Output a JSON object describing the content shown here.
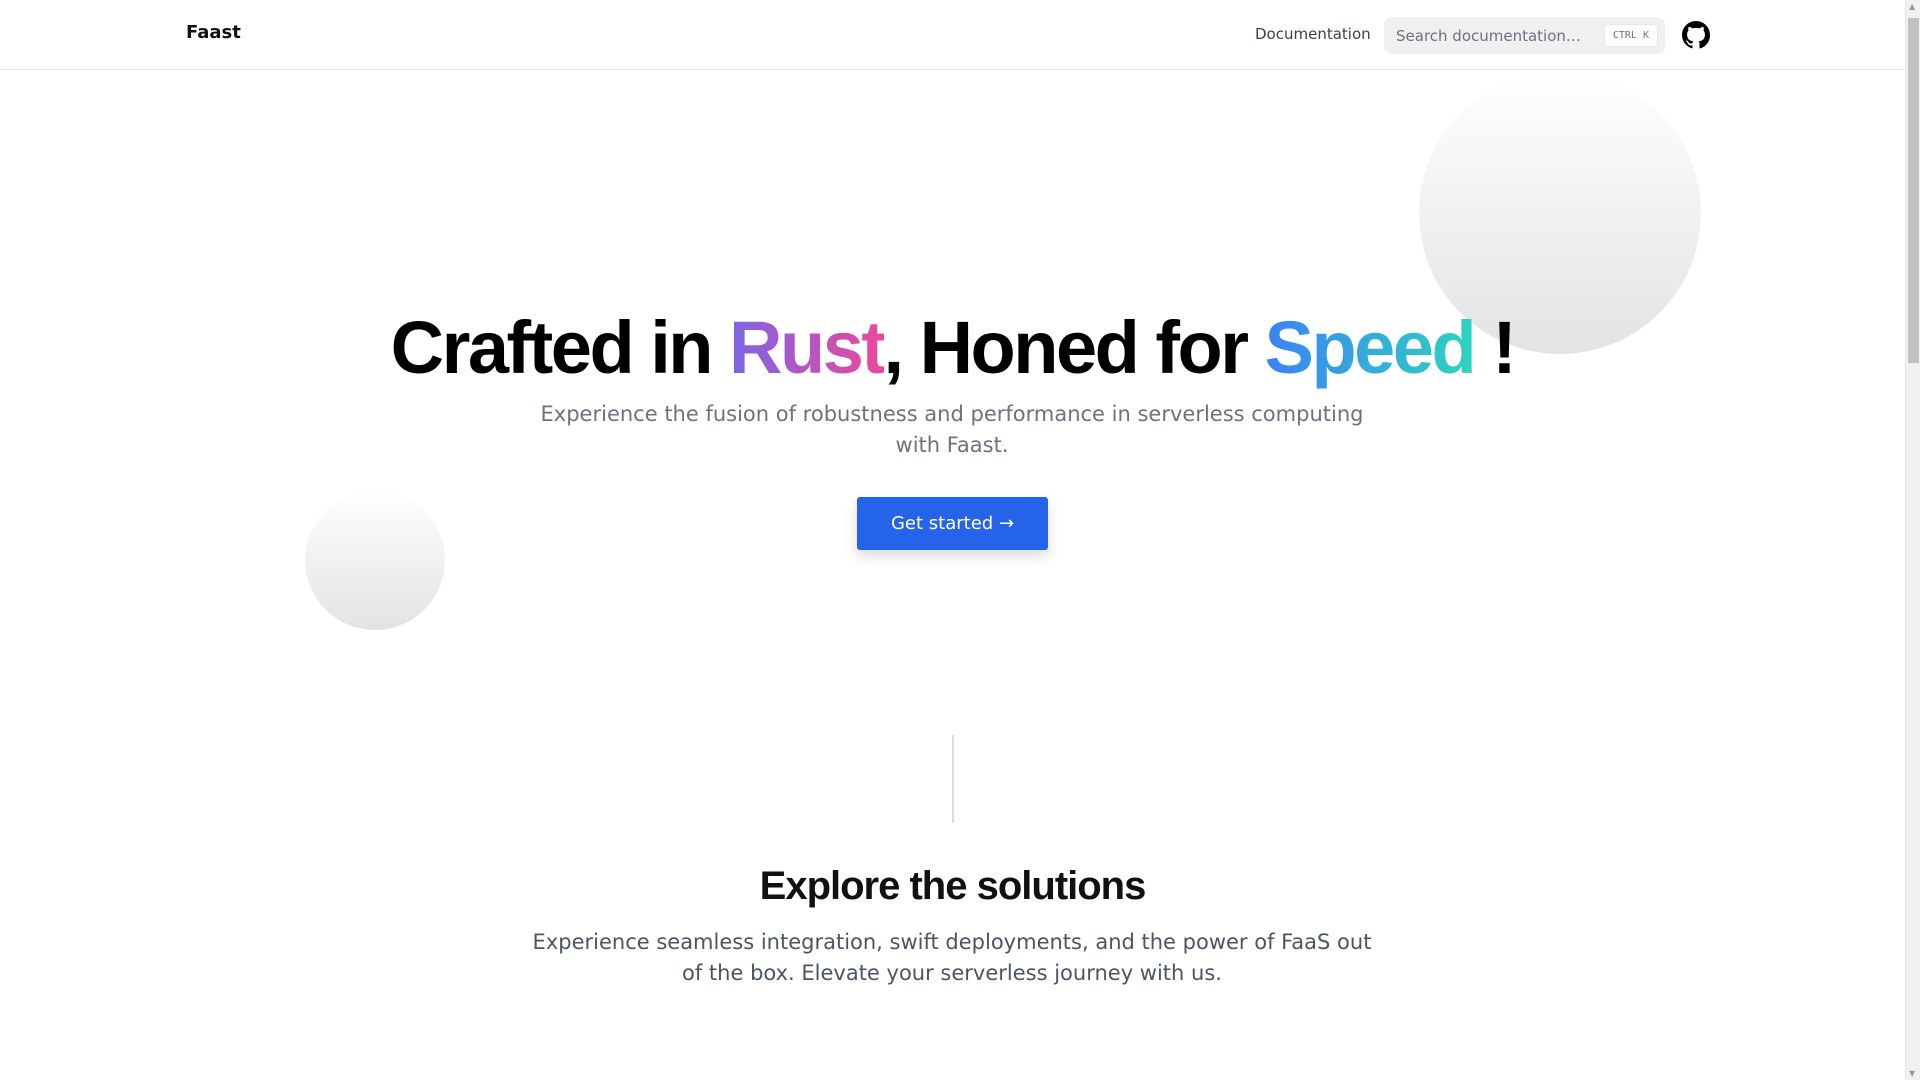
{
  "header": {
    "logo": "Faast",
    "nav_documentation": "Documentation",
    "search_placeholder": "Search documentation…",
    "search_shortcut": "CTRL K"
  },
  "hero": {
    "title_part1": "Crafted in ",
    "title_rust": "Rust",
    "title_part2": ", Honed for ",
    "title_speed": "Speed",
    "title_part3": " !",
    "subtitle": "Experience the fusion of robustness and performance in serverless computing with Faast.",
    "cta_label": "Get started",
    "cta_arrow": "→"
  },
  "solutions": {
    "title": "Explore the solutions",
    "description": "Experience seamless integration, swift deployments, and the power of FaaS out of the box. Elevate your serverless journey with us."
  },
  "colors": {
    "accent": "#2563eb",
    "rust_from": "#7c65e6",
    "rust_to": "#ec4899",
    "speed_from": "#3b82f6",
    "speed_to": "#2dd4bf"
  }
}
